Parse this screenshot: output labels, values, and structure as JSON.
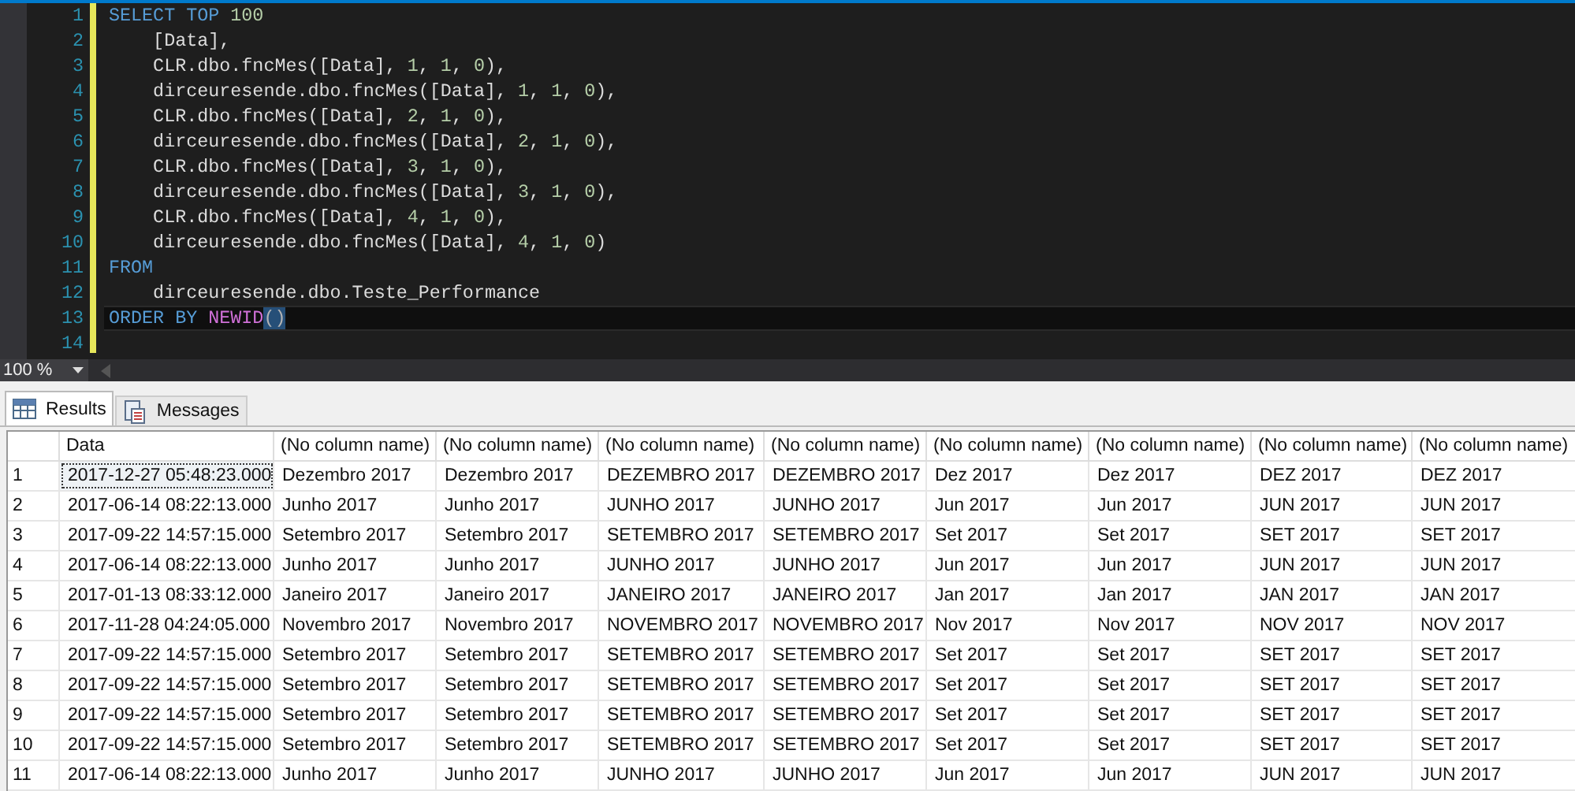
{
  "editor": {
    "lines": [
      {
        "number": "1",
        "current": false,
        "segments": [
          {
            "kind": "keyword",
            "text": "SELECT TOP "
          },
          {
            "kind": "number",
            "text": "100"
          }
        ]
      },
      {
        "number": "2",
        "current": false,
        "segments": [
          {
            "kind": "plain",
            "text": "    [Data],"
          }
        ]
      },
      {
        "number": "3",
        "current": false,
        "segments": [
          {
            "kind": "plain",
            "text": "    CLR.dbo.fncMes([Data], "
          },
          {
            "kind": "number",
            "text": "1"
          },
          {
            "kind": "plain",
            "text": ", "
          },
          {
            "kind": "number",
            "text": "1"
          },
          {
            "kind": "plain",
            "text": ", "
          },
          {
            "kind": "number",
            "text": "0"
          },
          {
            "kind": "plain",
            "text": "),"
          }
        ]
      },
      {
        "number": "4",
        "current": false,
        "segments": [
          {
            "kind": "plain",
            "text": "    dirceuresende.dbo.fncMes([Data], "
          },
          {
            "kind": "number",
            "text": "1"
          },
          {
            "kind": "plain",
            "text": ", "
          },
          {
            "kind": "number",
            "text": "1"
          },
          {
            "kind": "plain",
            "text": ", "
          },
          {
            "kind": "number",
            "text": "0"
          },
          {
            "kind": "plain",
            "text": "),"
          }
        ]
      },
      {
        "number": "5",
        "current": false,
        "segments": [
          {
            "kind": "plain",
            "text": "    CLR.dbo.fncMes([Data], "
          },
          {
            "kind": "number",
            "text": "2"
          },
          {
            "kind": "plain",
            "text": ", "
          },
          {
            "kind": "number",
            "text": "1"
          },
          {
            "kind": "plain",
            "text": ", "
          },
          {
            "kind": "number",
            "text": "0"
          },
          {
            "kind": "plain",
            "text": "),"
          }
        ]
      },
      {
        "number": "6",
        "current": false,
        "segments": [
          {
            "kind": "plain",
            "text": "    dirceuresende.dbo.fncMes([Data], "
          },
          {
            "kind": "number",
            "text": "2"
          },
          {
            "kind": "plain",
            "text": ", "
          },
          {
            "kind": "number",
            "text": "1"
          },
          {
            "kind": "plain",
            "text": ", "
          },
          {
            "kind": "number",
            "text": "0"
          },
          {
            "kind": "plain",
            "text": "),"
          }
        ]
      },
      {
        "number": "7",
        "current": false,
        "segments": [
          {
            "kind": "plain",
            "text": "    CLR.dbo.fncMes([Data], "
          },
          {
            "kind": "number",
            "text": "3"
          },
          {
            "kind": "plain",
            "text": ", "
          },
          {
            "kind": "number",
            "text": "1"
          },
          {
            "kind": "plain",
            "text": ", "
          },
          {
            "kind": "number",
            "text": "0"
          },
          {
            "kind": "plain",
            "text": "),"
          }
        ]
      },
      {
        "number": "8",
        "current": false,
        "segments": [
          {
            "kind": "plain",
            "text": "    dirceuresende.dbo.fncMes([Data], "
          },
          {
            "kind": "number",
            "text": "3"
          },
          {
            "kind": "plain",
            "text": ", "
          },
          {
            "kind": "number",
            "text": "1"
          },
          {
            "kind": "plain",
            "text": ", "
          },
          {
            "kind": "number",
            "text": "0"
          },
          {
            "kind": "plain",
            "text": "),"
          }
        ]
      },
      {
        "number": "9",
        "current": false,
        "segments": [
          {
            "kind": "plain",
            "text": "    CLR.dbo.fncMes([Data], "
          },
          {
            "kind": "number",
            "text": "4"
          },
          {
            "kind": "plain",
            "text": ", "
          },
          {
            "kind": "number",
            "text": "1"
          },
          {
            "kind": "plain",
            "text": ", "
          },
          {
            "kind": "number",
            "text": "0"
          },
          {
            "kind": "plain",
            "text": "),"
          }
        ]
      },
      {
        "number": "10",
        "current": false,
        "segments": [
          {
            "kind": "plain",
            "text": "    dirceuresende.dbo.fncMes([Data], "
          },
          {
            "kind": "number",
            "text": "4"
          },
          {
            "kind": "plain",
            "text": ", "
          },
          {
            "kind": "number",
            "text": "1"
          },
          {
            "kind": "plain",
            "text": ", "
          },
          {
            "kind": "number",
            "text": "0"
          },
          {
            "kind": "plain",
            "text": ")"
          }
        ]
      },
      {
        "number": "11",
        "current": false,
        "segments": [
          {
            "kind": "keyword",
            "text": "FROM"
          }
        ]
      },
      {
        "number": "12",
        "current": false,
        "segments": [
          {
            "kind": "plain",
            "text": "    dirceuresende.dbo.Teste_Performance"
          }
        ]
      },
      {
        "number": "13",
        "current": true,
        "segments": [
          {
            "kind": "keyword",
            "text": "ORDER BY "
          },
          {
            "kind": "function",
            "text": "NEWID"
          },
          {
            "kind": "brace",
            "text": "()"
          }
        ]
      },
      {
        "number": "14",
        "current": false
      }
    ]
  },
  "zoom": {
    "value": "100 %"
  },
  "tabs": [
    {
      "label": "Results",
      "selected": true,
      "kind": "grid"
    },
    {
      "label": "Messages",
      "selected": false,
      "kind": "messages"
    }
  ],
  "grid": {
    "columns": [
      "Data",
      "(No column name)",
      "(No column name)",
      "(No column name)",
      "(No column name)",
      "(No column name)",
      "(No column name)",
      "(No column name)",
      "(No column name)"
    ],
    "rows": [
      {
        "number": "1",
        "focused": true,
        "cells": [
          "2017-12-27 05:48:23.000",
          "Dezembro 2017",
          "Dezembro 2017",
          "DEZEMBRO 2017",
          "DEZEMBRO 2017",
          "Dez 2017",
          "Dez 2017",
          "DEZ 2017",
          "DEZ 2017"
        ]
      },
      {
        "number": "2",
        "focused": false,
        "cells": [
          "2017-06-14 08:22:13.000",
          "Junho 2017",
          "Junho 2017",
          "JUNHO 2017",
          "JUNHO 2017",
          "Jun 2017",
          "Jun 2017",
          "JUN 2017",
          "JUN 2017"
        ]
      },
      {
        "number": "3",
        "focused": false,
        "cells": [
          "2017-09-22 14:57:15.000",
          "Setembro 2017",
          "Setembro 2017",
          "SETEMBRO 2017",
          "SETEMBRO 2017",
          "Set 2017",
          "Set 2017",
          "SET 2017",
          "SET 2017"
        ]
      },
      {
        "number": "4",
        "focused": false,
        "cells": [
          "2017-06-14 08:22:13.000",
          "Junho 2017",
          "Junho 2017",
          "JUNHO 2017",
          "JUNHO 2017",
          "Jun 2017",
          "Jun 2017",
          "JUN 2017",
          "JUN 2017"
        ]
      },
      {
        "number": "5",
        "focused": false,
        "cells": [
          "2017-01-13 08:33:12.000",
          "Janeiro 2017",
          "Janeiro 2017",
          "JANEIRO 2017",
          "JANEIRO 2017",
          "Jan 2017",
          "Jan 2017",
          "JAN 2017",
          "JAN 2017"
        ]
      },
      {
        "number": "6",
        "focused": false,
        "cells": [
          "2017-11-28 04:24:05.000",
          "Novembro 2017",
          "Novembro 2017",
          "NOVEMBRO 2017",
          "NOVEMBRO 2017",
          "Nov 2017",
          "Nov 2017",
          "NOV 2017",
          "NOV 2017"
        ]
      },
      {
        "number": "7",
        "focused": false,
        "cells": [
          "2017-09-22 14:57:15.000",
          "Setembro 2017",
          "Setembro 2017",
          "SETEMBRO 2017",
          "SETEMBRO 2017",
          "Set 2017",
          "Set 2017",
          "SET 2017",
          "SET 2017"
        ]
      },
      {
        "number": "8",
        "focused": false,
        "cells": [
          "2017-09-22 14:57:15.000",
          "Setembro 2017",
          "Setembro 2017",
          "SETEMBRO 2017",
          "SETEMBRO 2017",
          "Set 2017",
          "Set 2017",
          "SET 2017",
          "SET 2017"
        ]
      },
      {
        "number": "9",
        "focused": false,
        "cells": [
          "2017-09-22 14:57:15.000",
          "Setembro 2017",
          "Setembro 2017",
          "SETEMBRO 2017",
          "SETEMBRO 2017",
          "Set 2017",
          "Set 2017",
          "SET 2017",
          "SET 2017"
        ]
      },
      {
        "number": "10",
        "focused": false,
        "cells": [
          "2017-09-22 14:57:15.000",
          "Setembro 2017",
          "Setembro 2017",
          "SETEMBRO 2017",
          "SETEMBRO 2017",
          "Set 2017",
          "Set 2017",
          "SET 2017",
          "SET 2017"
        ]
      },
      {
        "number": "11",
        "focused": false,
        "cells": [
          "2017-06-14 08:22:13.000",
          "Junho 2017",
          "Junho 2017",
          "JUNHO 2017",
          "JUNHO 2017",
          "Jun 2017",
          "Jun 2017",
          "JUN 2017",
          "JUN 2017"
        ]
      }
    ]
  }
}
